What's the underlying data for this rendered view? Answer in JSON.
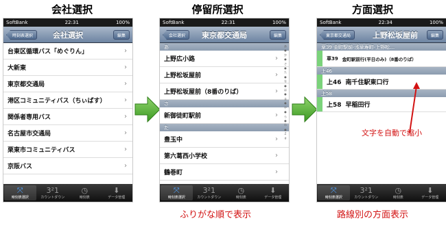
{
  "headings": [
    "会社選択",
    "停留所選択",
    "方面選択"
  ],
  "phone1": {
    "status": {
      "carrier": "SoftBank",
      "time": "22:31",
      "battery": "100%"
    },
    "nav": {
      "back": "時刻表選択",
      "title": "会社選択",
      "edit": "編集"
    },
    "items": [
      "台東区循環バス「めぐりん」",
      "大新東",
      "東京都交通局",
      "港区コミュニティバス（ちぃばす）",
      "関係者専用バス",
      "名古屋市交通局",
      "栗東市コミュニティバス",
      "京阪バス"
    ]
  },
  "phone2": {
    "status": {
      "carrier": "SoftBank",
      "time": "22:31",
      "battery": "100%"
    },
    "nav": {
      "back": "会社選択",
      "title": "東京都交通局",
      "edit": "編集"
    },
    "sections": [
      {
        "header": "あ",
        "items": [
          "上野広小路",
          "上野松坂屋前",
          "上野松坂屋前（8番のりば）"
        ]
      },
      {
        "header": "さ",
        "items": [
          "新御徒町駅前"
        ]
      },
      {
        "header": "た",
        "items": [
          "豊玉中",
          "第六葛西小学校",
          "鶴巻町"
        ]
      }
    ],
    "index": [
      "あ",
      "●",
      "か",
      "●",
      "さ",
      "●",
      "た",
      "●",
      "な",
      "●",
      "は",
      "●",
      "ま",
      "●",
      "や",
      "●",
      "ら",
      "●",
      "わ",
      "●",
      "Z",
      "#"
    ]
  },
  "phone3": {
    "status": {
      "carrier": "SoftBank",
      "time": "22:34",
      "battery": "100%"
    },
    "nav": {
      "back": "東京都交通局",
      "title": "上野松坂屋前",
      "edit": "編集"
    },
    "top_header": "草39 金町駅前-浅草寿町-上野松…",
    "routes": [
      {
        "header": "",
        "code": "草39",
        "name": "金町駅前行(平日のみ)（8番のりば）",
        "small": true
      },
      {
        "header": "上46",
        "code": "上46",
        "name": "南千住駅東口行",
        "small": false
      },
      {
        "header": "上58",
        "code": "上58",
        "name": "早稲田行",
        "small": false
      }
    ]
  },
  "tabs": [
    "時刻表選択",
    "カウントダウン",
    "時刻表",
    "データ管理"
  ],
  "tab_icons": [
    "route-icon",
    "countdown-icon",
    "clock-icon",
    "download-icon"
  ],
  "captions": {
    "shrink": "文字を自動で縮小",
    "furigana": "ふりがな順で表示",
    "per_route": "路線別の方面表示"
  },
  "colors": {
    "accent_green": "#4caf2e",
    "caption_red": "#d21212",
    "route_green": "#7bd37b"
  }
}
